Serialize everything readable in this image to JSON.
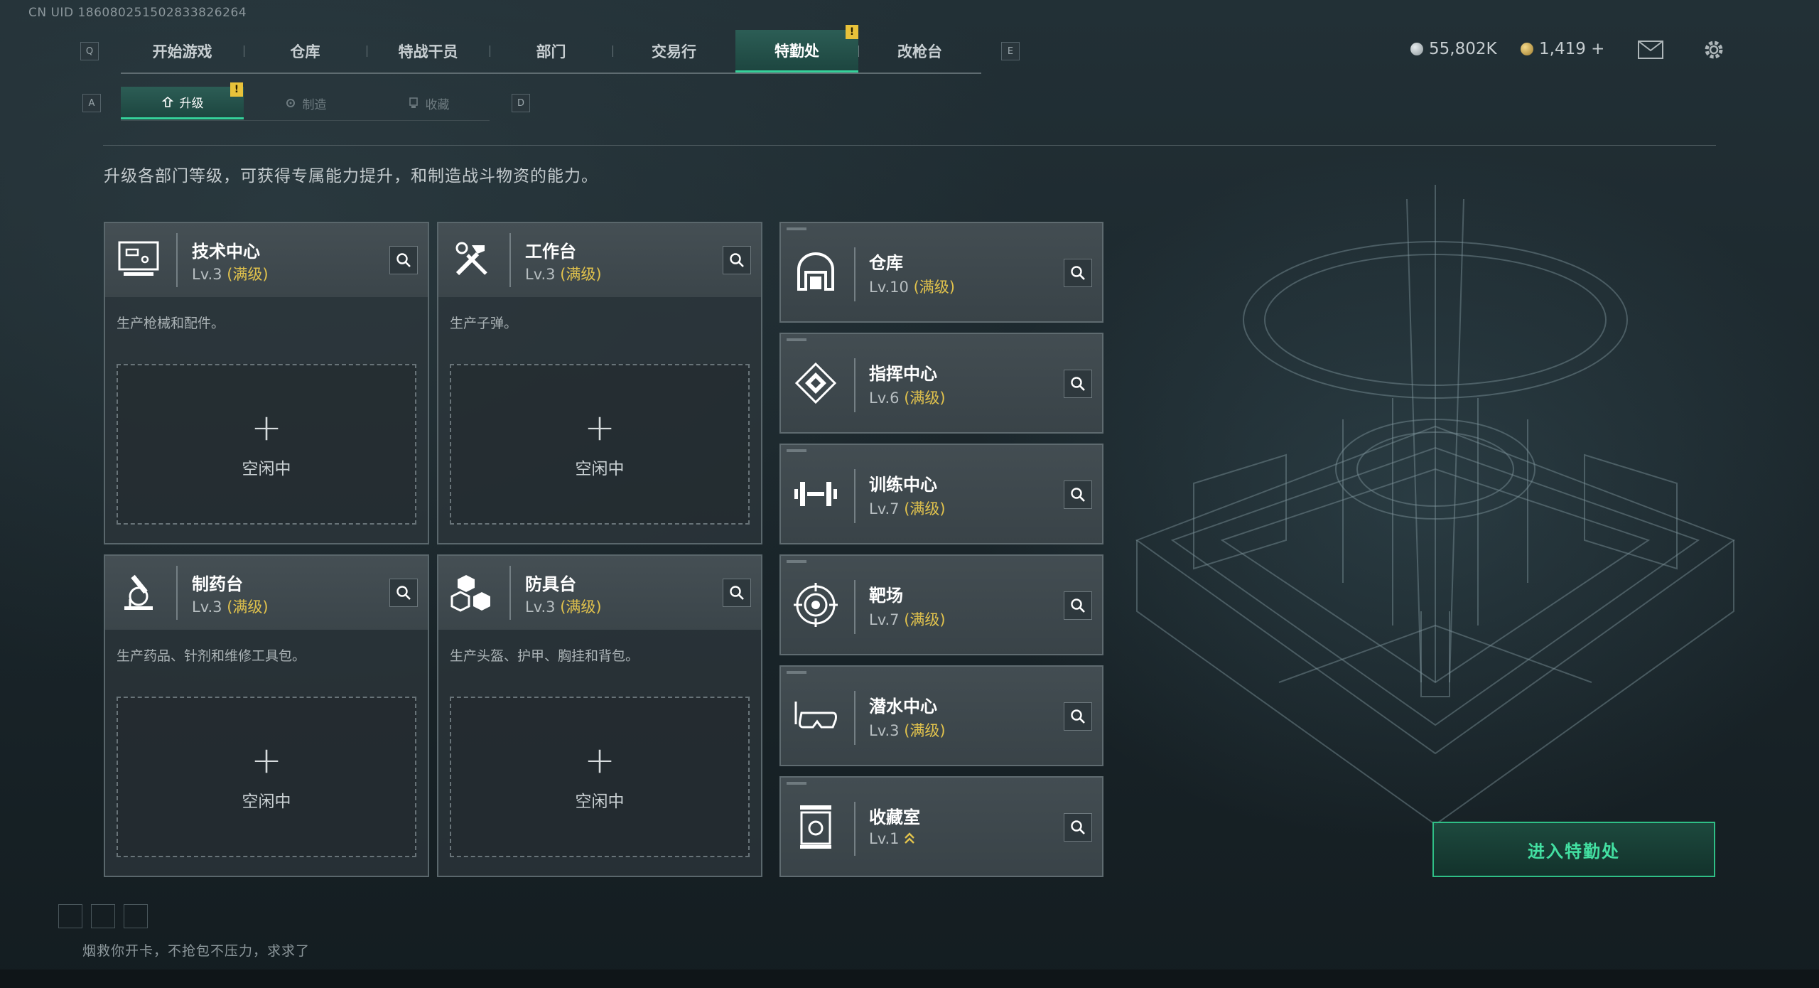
{
  "uid": "CN UID 18608025150283​3826264",
  "keys": {
    "left": "Q",
    "right": "E",
    "sub_left": "A",
    "sub_right": "D"
  },
  "nav": {
    "tabs": [
      "开始游戏",
      "仓库",
      "特战干员",
      "部门",
      "交易行",
      "特勤处",
      "改枪台"
    ],
    "active": "特勤处",
    "badge": "!"
  },
  "subnav": {
    "tabs": [
      "升级",
      "制造",
      "收藏"
    ],
    "active": "升级",
    "badge": "!"
  },
  "currency": {
    "silver": "55,802K",
    "gold": "1,419 +"
  },
  "description": "升级各部门等级，可获得专属能力提升，和制造战斗物资的能力。",
  "production": [
    {
      "name": "技术中心",
      "level": "Lv.3",
      "max": "(满级)",
      "desc": "生产枪械和配件。",
      "idle": "空闲中",
      "icon": "monitor-icon"
    },
    {
      "name": "工作台",
      "level": "Lv.3",
      "max": "(满级)",
      "desc": "生产子弹。",
      "idle": "空闲中",
      "icon": "tools-icon"
    },
    {
      "name": "制药台",
      "level": "Lv.3",
      "max": "(满级)",
      "desc": "生产药品、针剂和维修工具包。",
      "idle": "空闲中",
      "icon": "microscope-icon"
    },
    {
      "name": "防具台",
      "level": "Lv.3",
      "max": "(满级)",
      "desc": "生产头盔、护甲、胸挂和背包。",
      "idle": "空闲中",
      "icon": "cubes-icon"
    }
  ],
  "facilities": [
    {
      "name": "仓库",
      "level": "Lv.10",
      "max": "(满级)",
      "icon": "warehouse-icon"
    },
    {
      "name": "指挥中心",
      "level": "Lv.6",
      "max": "(满级)",
      "icon": "command-icon"
    },
    {
      "name": "训练中心",
      "level": "Lv.7",
      "max": "(满级)",
      "icon": "dumbbell-icon"
    },
    {
      "name": "靶场",
      "level": "Lv.7",
      "max": "(满级)",
      "icon": "target-icon"
    },
    {
      "name": "潜水中心",
      "level": "Lv.3",
      "max": "(满级)",
      "icon": "goggles-icon"
    },
    {
      "name": "收藏室",
      "level": "Lv.1",
      "max": "",
      "icon": "vault-icon"
    }
  ],
  "enter_button": "进入特勤处",
  "footer": "烟救你开卡，不抢包不压力，求求了",
  "colors": {
    "accent": "#35d19a",
    "max_level": "#e2c34c",
    "badge": "#e8c23a"
  }
}
